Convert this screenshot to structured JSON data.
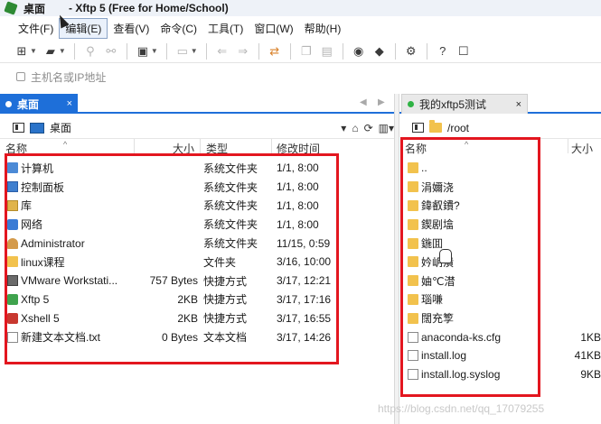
{
  "titlebar": {
    "title_left": "桌面",
    "title_app": "- Xftp 5 (Free for Home/School)"
  },
  "menu": [
    {
      "label": "文件(F)"
    },
    {
      "label": "编辑(E)"
    },
    {
      "label": "查看(V)"
    },
    {
      "label": "命令(C)"
    },
    {
      "label": "工具(T)"
    },
    {
      "label": "窗口(W)"
    },
    {
      "label": "帮助(H)"
    }
  ],
  "address": {
    "placeholder": "主机名或IP地址"
  },
  "left_pane": {
    "tab_label": "桌面",
    "tab_close": "×",
    "path": "桌面",
    "columns": {
      "name": "名称",
      "size": "大小",
      "type": "类型",
      "time": "修改时间"
    },
    "rows": [
      {
        "icon": "computer-icon",
        "name": "计算机",
        "size": "",
        "type": "系统文件夹",
        "time": "1/1, 8:00"
      },
      {
        "icon": "control-panel-icon",
        "name": "控制面板",
        "size": "",
        "type": "系统文件夹",
        "time": "1/1, 8:00"
      },
      {
        "icon": "library-icon",
        "name": "库",
        "size": "",
        "type": "系统文件夹",
        "time": "1/1, 8:00"
      },
      {
        "icon": "network-icon",
        "name": "网络",
        "size": "",
        "type": "系统文件夹",
        "time": "1/1, 8:00"
      },
      {
        "icon": "user-folder-icon",
        "name": "Administrator",
        "size": "",
        "type": "系统文件夹",
        "time": "11/15, 0:59"
      },
      {
        "icon": "folder-icon",
        "name": "linux课程",
        "size": "",
        "type": "文件夹",
        "time": "3/16, 10:00"
      },
      {
        "icon": "vmware-shortcut-icon",
        "name": "VMware Workstati...",
        "size": "757 Bytes",
        "type": "快捷方式",
        "time": "3/17, 12:21"
      },
      {
        "icon": "xftp-shortcut-icon",
        "name": "Xftp 5",
        "size": "2KB",
        "type": "快捷方式",
        "time": "3/17, 17:16"
      },
      {
        "icon": "xshell-shortcut-icon",
        "name": "Xshell 5",
        "size": "2KB",
        "type": "快捷方式",
        "time": "3/17, 16:55"
      },
      {
        "icon": "text-file-icon",
        "name": "新建文本文档.txt",
        "size": "0 Bytes",
        "type": "文本文档",
        "time": "3/17, 14:26"
      }
    ]
  },
  "right_pane": {
    "tab_label": "我的xftp5测试",
    "tab_close": "×",
    "path": "/root",
    "columns": {
      "name": "名称",
      "size": "大小"
    },
    "rows": [
      {
        "icon": "parent-folder-icon",
        "name": "..",
        "size": ""
      },
      {
        "icon": "folder-icon",
        "name": "涓嬭浇",
        "size": ""
      },
      {
        "icon": "folder-icon",
        "name": "鍏叡鐨?",
        "size": ""
      },
      {
        "icon": "folder-icon",
        "name": "鍥剧墖",
        "size": ""
      },
      {
        "icon": "folder-icon",
        "name": "鍦囬",
        "size": ""
      },
      {
        "icon": "folder-icon",
        "name": "妗岄潰",
        "size": ""
      },
      {
        "icon": "folder-icon",
        "name": "妯℃澘",
        "size": ""
      },
      {
        "icon": "folder-icon",
        "name": "瑙嗛",
        "size": ""
      },
      {
        "icon": "folder-icon",
        "name": "闊充箰",
        "size": ""
      },
      {
        "icon": "text-file-icon",
        "name": "anaconda-ks.cfg",
        "size": "1KB"
      },
      {
        "icon": "text-file-icon",
        "name": "install.log",
        "size": "41KB"
      },
      {
        "icon": "text-file-icon",
        "name": "install.log.syslog",
        "size": "9KB"
      }
    ]
  },
  "watermark": "https://blog.csdn.net/qq_17079255",
  "colors": {
    "accent_blue": "#1e6fd9",
    "highlight_red": "#e3161f",
    "folder_yellow": "#f2c24d",
    "connected_green": "#2fb344"
  }
}
